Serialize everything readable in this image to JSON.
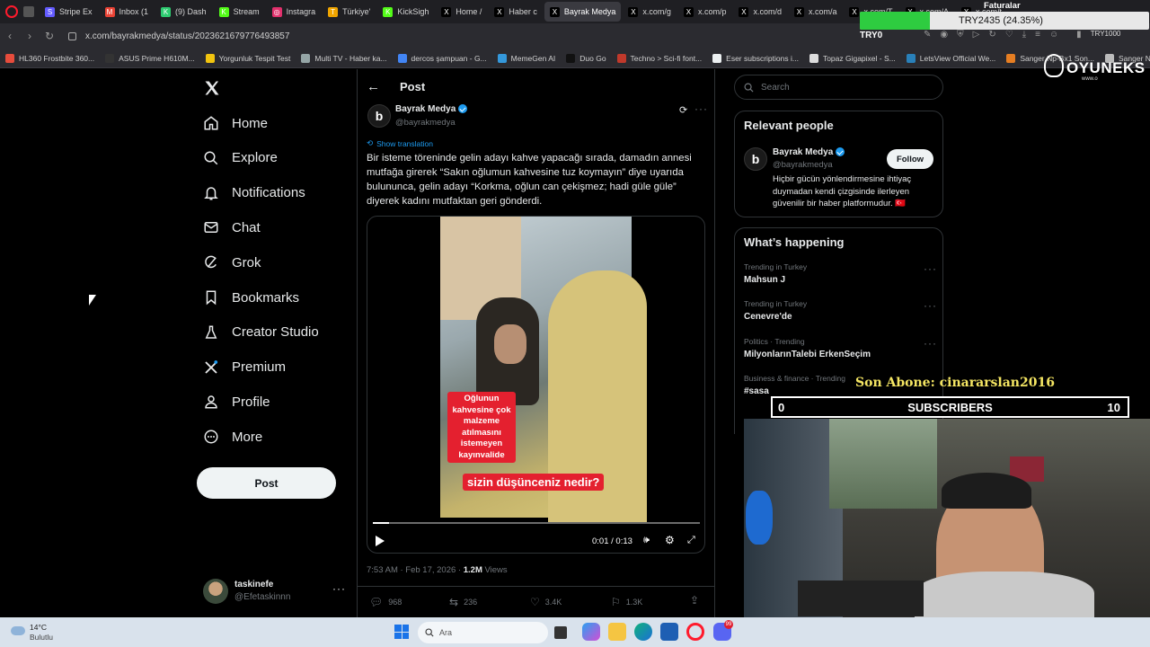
{
  "browser": {
    "tabs": [
      {
        "label": "Stripe Ex",
        "color": "#635bff",
        "glyph": "S"
      },
      {
        "label": "Inbox (1",
        "color": "#ea4335",
        "glyph": "M"
      },
      {
        "label": "(9) Dash",
        "color": "#2ecc71",
        "glyph": "K"
      },
      {
        "label": "Stream",
        "color": "#53fc18",
        "glyph": "K"
      },
      {
        "label": "Instagra",
        "color": "#e1306c",
        "glyph": "◎"
      },
      {
        "label": "Türkiye'",
        "color": "#f0a500",
        "glyph": "T"
      },
      {
        "label": "KickSigh",
        "color": "#53fc18",
        "glyph": "K"
      },
      {
        "label": "Home /",
        "color": "#000000",
        "glyph": "X"
      },
      {
        "label": "Haber c",
        "color": "#000000",
        "glyph": "X"
      },
      {
        "label": "Bayrak Medya",
        "color": "#000000",
        "glyph": "X",
        "active": true
      },
      {
        "label": "x.com/g",
        "color": "#000000",
        "glyph": "X"
      },
      {
        "label": "x.com/p",
        "color": "#000000",
        "glyph": "X"
      },
      {
        "label": "x.com/d",
        "color": "#000000",
        "glyph": "X"
      },
      {
        "label": "x.com/a",
        "color": "#000000",
        "glyph": "X"
      },
      {
        "label": "x.com/T",
        "color": "#000000",
        "glyph": "X"
      },
      {
        "label": "x.com/A",
        "color": "#000000",
        "glyph": "X"
      },
      {
        "label": "x.com/t",
        "color": "#000000",
        "glyph": "X"
      }
    ],
    "url": "x.com/bayrakmedya/status/2023621679776493857",
    "extension_badge": "TRY1000",
    "bookmarks": [
      {
        "label": "HL360 Frostbite 360...",
        "color": "#e74c3c"
      },
      {
        "label": "ASUS Prime H610M...",
        "color": "#333333"
      },
      {
        "label": "Yorgunluk Tespit Test",
        "color": "#f1c40f"
      },
      {
        "label": "Multi TV - Haber ka...",
        "color": "#95a5a6"
      },
      {
        "label": "dercos şampuan - G...",
        "color": "#4285f4"
      },
      {
        "label": "MemeGen AI",
        "color": "#3498db"
      },
      {
        "label": "Duo Go",
        "color": "#111111"
      },
      {
        "label": "Techno > Sci-fi font...",
        "color": "#c0392b"
      },
      {
        "label": "Eser subscriptions i...",
        "color": "#ecf0f1"
      },
      {
        "label": "Topaz Gigapixel - S...",
        "color": "#dddddd"
      },
      {
        "label": "LetsView Official We...",
        "color": "#2980b9"
      },
      {
        "label": "Sanger Np-Bx1 Son...",
        "color": "#e67e22"
      },
      {
        "label": "Sanger Np-BX1 Son...",
        "color": "#bbbbbb"
      }
    ]
  },
  "nav": {
    "items": [
      {
        "label": "Home",
        "icon": "home-icon"
      },
      {
        "label": "Explore",
        "icon": "search-icon"
      },
      {
        "label": "Notifications",
        "icon": "bell-icon"
      },
      {
        "label": "Chat",
        "icon": "mail-icon"
      },
      {
        "label": "Grok",
        "icon": "grok-icon"
      },
      {
        "label": "Bookmarks",
        "icon": "bookmark-icon"
      },
      {
        "label": "Creator Studio",
        "icon": "flask-icon"
      },
      {
        "label": "Premium",
        "icon": "x-premium-icon"
      },
      {
        "label": "Profile",
        "icon": "person-icon"
      },
      {
        "label": "More",
        "icon": "more-circle-icon"
      }
    ],
    "post_button": "Post",
    "account": {
      "name": "taskinefe",
      "handle": "@Efetaskinnn"
    }
  },
  "post": {
    "header_title": "Post",
    "author_name": "Bayrak Medya",
    "author_handle": "@bayrakmedya",
    "show_translation": "Show translation",
    "text": "Bir isteme töreninde gelin adayı kahve yapacağı sırada, damadın annesi mutfağa girerek “Sakın oğlumun kahvesine tuz koymayın” diye uyarıda bulununca, gelin adayı “Korkma, oğlun can çekişmez; hadi güle güle” diyerek kadını mutfaktan geri gönderdi.",
    "video": {
      "caption": "Oğlunun kahvesine çok malzeme atılmasını istemeyen kayınvalide",
      "question": "sizin düşünceniz nedir?",
      "time": "0:01 / 0:13",
      "progress": 0.05
    },
    "timestamp": "7:53 AM · Feb 17, 2026 · ",
    "views_count": "1.2M",
    "views_label": " Views",
    "stats": {
      "replies": "968",
      "reposts": "236",
      "likes": "3.4K",
      "bookmarks": "1.3K"
    }
  },
  "sidebar": {
    "search_placeholder": "Search",
    "relevant_title": "Relevant people",
    "person": {
      "name": "Bayrak Medya",
      "handle": "@bayrakmedya",
      "follow": "Follow",
      "bio": "Hiçbir gücün yönlendirmesine ihtiyaç duymadan kendi çizgisinde ilerleyen güvenilir bir haber platformudur. 🇹🇷"
    },
    "happening_title": "What’s happening",
    "trends": [
      {
        "context": "Trending in Turkey",
        "title": "Mahsun J"
      },
      {
        "context": "Trending in Turkey",
        "title": "Cenevre'de"
      },
      {
        "context": "Politics · Trending",
        "title": "MilyonlarınTalebi ErkenSeçim"
      },
      {
        "context": "Business & finance · Trending",
        "title": "#sasa"
      }
    ]
  },
  "overlay": {
    "faturalar": "Faturalar",
    "goal_text": "TRY2435 (24.35%)",
    "goal_progress": 0.2435,
    "try0": "TRY0",
    "oyuneks": "OYUNEKS",
    "oyuneks_sub": "www.o",
    "last_sub": "Son Abone: cinararslan2016",
    "sub_left": "0",
    "sub_label": "SUBSCRIBERS",
    "sub_right": "10"
  },
  "taskbar": {
    "weather_temp": "14°C",
    "weather_desc": "Bulutlu",
    "search_placeholder": "Ara",
    "discord_badge": "99"
  }
}
